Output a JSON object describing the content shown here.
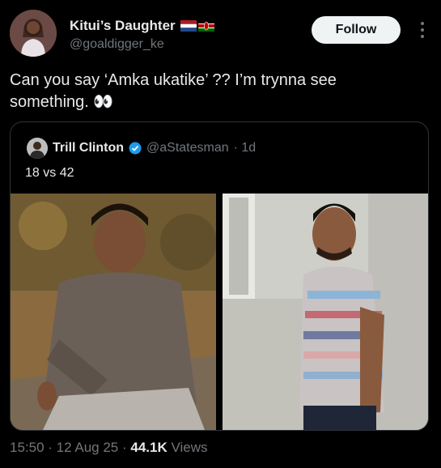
{
  "author": {
    "display_name": "Kitui’s Daughter",
    "handle": "@goaldigger_ke",
    "avatar_icon": "profile-photo"
  },
  "follow_label": "Follow",
  "tweet": {
    "text": "Can you say ‘Amka ukatike’ ?? I’m trynna see something. 👀"
  },
  "quoted": {
    "display_name": "Trill Clinton",
    "handle": "@aStatesman",
    "age": "· 1d",
    "text": "18 vs 42",
    "verified_color": "#1d9bf0"
  },
  "meta": {
    "time": "15:50",
    "date": "12 Aug 25",
    "views": "44.1K",
    "views_label": "Views"
  },
  "colors": {
    "background": "#000000",
    "text": "#e7e9ea",
    "muted": "#71767b",
    "border": "#2f3336"
  }
}
